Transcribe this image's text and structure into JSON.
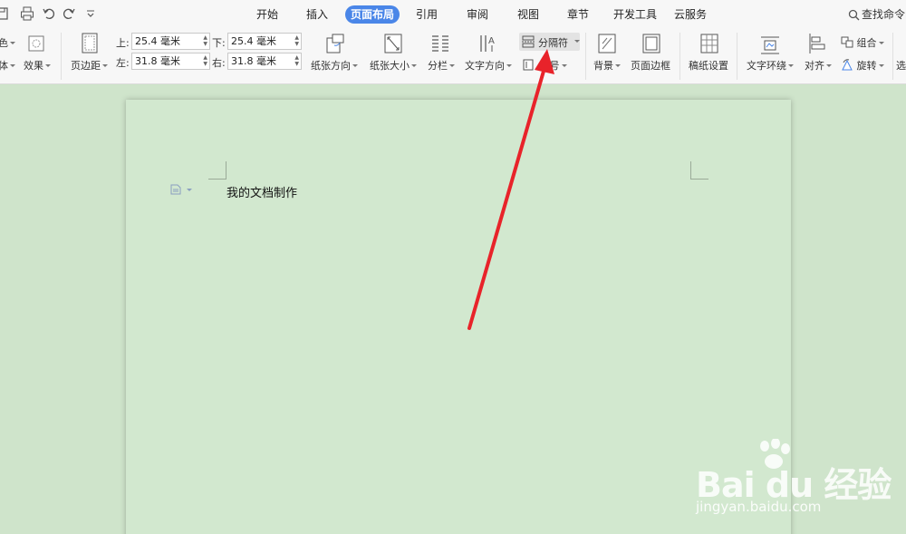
{
  "quick_access": [
    "save-icon",
    "print-icon",
    "undo-icon",
    "redo-icon",
    "more-icon"
  ],
  "menu_tabs": [
    "开始",
    "插入",
    "页面布局",
    "引用",
    "审阅",
    "视图",
    "章节",
    "开发工具",
    "云服务"
  ],
  "active_tab": "页面布局",
  "search_label": "查找命令",
  "ribbon": {
    "color_label": "色",
    "font_label": "体",
    "effects_label": "效果",
    "margins_label": "页边距",
    "top_label": "上:",
    "top_value": "25.4 毫米",
    "bottom_label": "下:",
    "bottom_value": "25.4 毫米",
    "left_label": "左:",
    "left_value": "31.8 毫米",
    "right_label": "右:",
    "right_value": "31.8 毫米",
    "orientation_label": "纸张方向",
    "size_label": "纸张大小",
    "columns_label": "分栏",
    "text_direction_label": "文字方向",
    "breaks_label": "分隔符",
    "line_numbers_label": "行号",
    "background_label": "背景",
    "page_border_label": "页面边框",
    "manuscript_label": "稿纸设置",
    "text_wrap_label": "文字环绕",
    "align_label": "对齐",
    "group_label": "组合",
    "rotate_label": "旋转",
    "select_label": "选"
  },
  "document": {
    "text": "我的文档制作"
  },
  "watermark": {
    "logo": "Bai du 经验",
    "url": "jingyan.baidu.com"
  },
  "colors": {
    "accent": "#4a86e8",
    "page_bg": "#d2e8cf",
    "workspace_bg": "#cfe4cb",
    "arrow": "#e8232a"
  }
}
